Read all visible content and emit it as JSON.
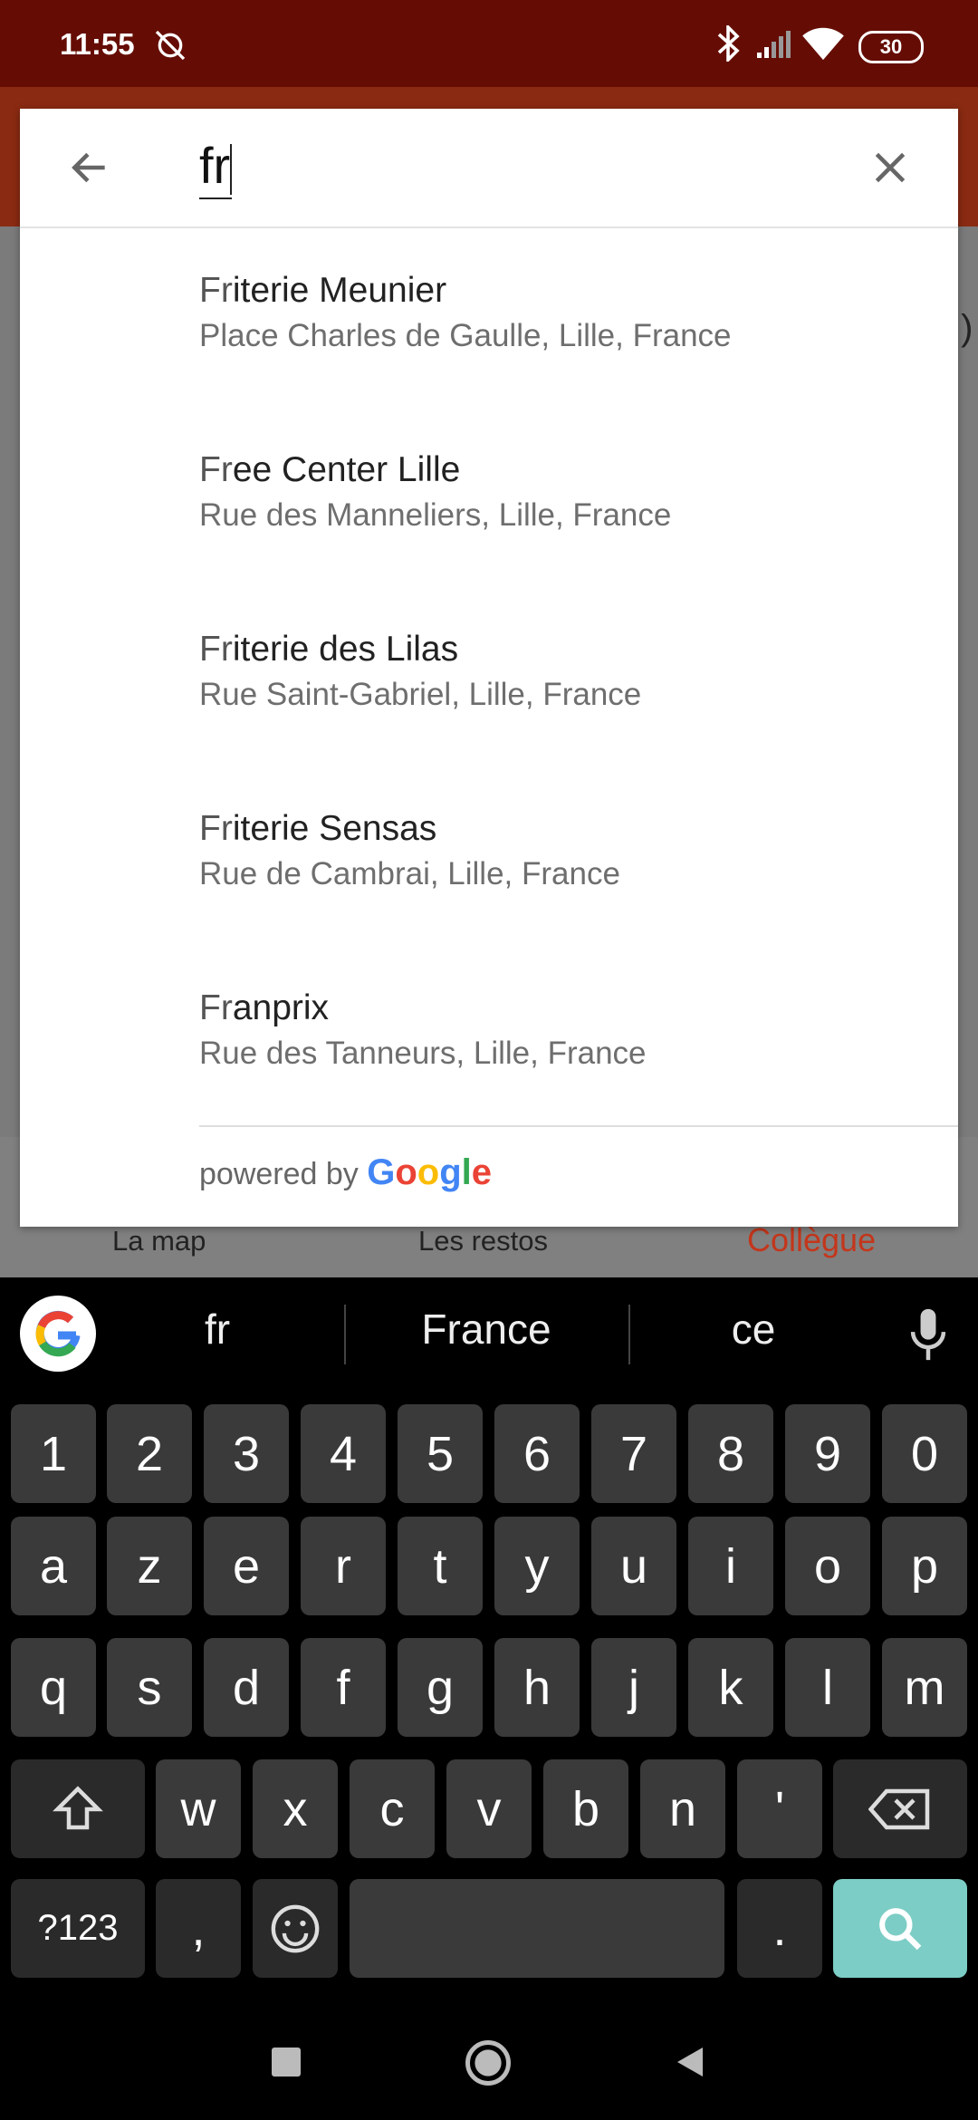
{
  "status_bar": {
    "time": "11:55",
    "battery": "30"
  },
  "bottom_nav": {
    "items": [
      "La map",
      "Les restos",
      "Collègue"
    ],
    "active_color": "#c4361b"
  },
  "search": {
    "query": "fr"
  },
  "results": [
    {
      "match": "Fr",
      "rest": "iterie Meunier",
      "address": "Place Charles de Gaulle, Lille, France"
    },
    {
      "match": "Fr",
      "rest": "ee Center Lille",
      "address": "Rue des Manneliers, Lille, France"
    },
    {
      "match": "Fr",
      "rest": "iterie des Lilas",
      "address": "Rue Saint-Gabriel, Lille, France"
    },
    {
      "match": "Fr",
      "rest": "iterie Sensas",
      "address": "Rue de Cambrai, Lille, France"
    },
    {
      "match": "Fr",
      "rest": "anprix",
      "address": "Rue des Tanneurs, Lille, France"
    }
  ],
  "attribution": {
    "prefix": "powered by",
    "brand": [
      "G",
      "o",
      "o",
      "g",
      "l",
      "e"
    ],
    "brand_colors": [
      "#4285F4",
      "#EA4335",
      "#FBBC05",
      "#4285F4",
      "#34A853",
      "#EA4335"
    ]
  },
  "keyboard": {
    "suggestions": [
      "fr",
      "France",
      "ce"
    ],
    "row_numbers": [
      "1",
      "2",
      "3",
      "4",
      "5",
      "6",
      "7",
      "8",
      "9",
      "0"
    ],
    "row1": [
      "a",
      "z",
      "e",
      "r",
      "t",
      "y",
      "u",
      "i",
      "o",
      "p"
    ],
    "row2": [
      "q",
      "s",
      "d",
      "f",
      "g",
      "h",
      "j",
      "k",
      "l",
      "m"
    ],
    "row3": [
      "w",
      "x",
      "c",
      "v",
      "b",
      "n",
      "'"
    ],
    "symbols_label": "?123",
    "comma": ",",
    "period": ".",
    "action_color": "#7ccdc5"
  }
}
